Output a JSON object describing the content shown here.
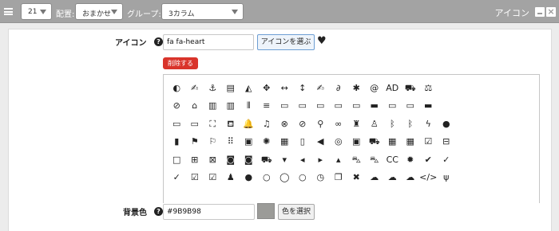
{
  "topbar": {
    "count_value": "21",
    "placement_label": "配置:",
    "placement_value": "おまかせ",
    "group_label": "グループ:",
    "group_value": "3カラム",
    "panel_title": "アイコン",
    "minimize_icon": "minus-icon",
    "close_icon": "close-icon"
  },
  "form": {
    "icon_label": "アイコン",
    "icon_value": "fa fa-heart",
    "choose_icon_button": "アイコンを選ぶ",
    "preview_icon": "♥",
    "delete_button": "削除する",
    "bg_label": "背景色",
    "bg_value": "#9B9B98",
    "bg_color": "#9B9B98",
    "choose_color_button": "色を選択"
  },
  "icons": [
    {
      "name": "adjust-icon",
      "g": "◐"
    },
    {
      "name": "american-sign-language-icon",
      "g": "✍"
    },
    {
      "name": "anchor-icon",
      "g": "⚓"
    },
    {
      "name": "archive-icon",
      "g": "▤"
    },
    {
      "name": "area-chart-icon",
      "g": "◭"
    },
    {
      "name": "arrows-icon",
      "g": "✥"
    },
    {
      "name": "arrows-h-icon",
      "g": "↔"
    },
    {
      "name": "arrows-v-icon",
      "g": "↕"
    },
    {
      "name": "asl-interpreting-icon",
      "g": "✍"
    },
    {
      "name": "assistive-listening-icon",
      "g": "∂"
    },
    {
      "name": "asterisk-icon",
      "g": "✱"
    },
    {
      "name": "at-icon",
      "g": "@"
    },
    {
      "name": "audio-description-icon",
      "g": "AD"
    },
    {
      "name": "automobile-icon",
      "g": "⛟"
    },
    {
      "name": "balance-scale-icon",
      "g": "⚖"
    },
    {
      "name": "blank-1",
      "g": ""
    },
    {
      "name": "blank-2",
      "g": ""
    },
    {
      "name": "blank-3",
      "g": ""
    },
    {
      "name": "blank-4",
      "g": ""
    },
    {
      "name": "blank-5",
      "g": ""
    },
    {
      "name": "ban-icon",
      "g": "⊘"
    },
    {
      "name": "bank-icon",
      "g": "⌂"
    },
    {
      "name": "bar-chart-icon",
      "g": "▥"
    },
    {
      "name": "bar-chart-o-icon",
      "g": "▥"
    },
    {
      "name": "barcode-icon",
      "g": "⦀"
    },
    {
      "name": "bars-icon",
      "g": "≡"
    },
    {
      "name": "battery-empty-icon",
      "g": "▭"
    },
    {
      "name": "battery-quarter-icon",
      "g": "▭"
    },
    {
      "name": "battery-half-icon",
      "g": "▭"
    },
    {
      "name": "battery-three-quarters-icon",
      "g": "▭"
    },
    {
      "name": "battery-empty-2-icon",
      "g": "▭"
    },
    {
      "name": "battery-full-icon",
      "g": "▬"
    },
    {
      "name": "battery-quarter-2-icon",
      "g": "▭"
    },
    {
      "name": "battery-half-2-icon",
      "g": "▭"
    },
    {
      "name": "battery-full-2-icon",
      "g": "▬"
    },
    {
      "name": "blank-6",
      "g": ""
    },
    {
      "name": "blank-7",
      "g": ""
    },
    {
      "name": "blank-8",
      "g": ""
    },
    {
      "name": "blank-9",
      "g": ""
    },
    {
      "name": "blank-10",
      "g": ""
    },
    {
      "name": "battery-three-quarters-2-icon",
      "g": "▭"
    },
    {
      "name": "battery-half-3-icon",
      "g": "▭"
    },
    {
      "name": "bed-icon",
      "g": "⛶"
    },
    {
      "name": "beer-icon",
      "g": "⛾"
    },
    {
      "name": "bell-icon",
      "g": "🔔"
    },
    {
      "name": "bell-o-icon",
      "g": "♫"
    },
    {
      "name": "bell-slash-icon",
      "g": "⊗"
    },
    {
      "name": "bell-slash-o-icon",
      "g": "⊘"
    },
    {
      "name": "bicycle-icon",
      "g": "⚲"
    },
    {
      "name": "binoculars-icon",
      "g": "∞"
    },
    {
      "name": "birthday-cake-icon",
      "g": "♜"
    },
    {
      "name": "blind-icon",
      "g": "♙"
    },
    {
      "name": "bluetooth-icon",
      "g": "ᛒ"
    },
    {
      "name": "bluetooth-b-icon",
      "g": "ᛒ"
    },
    {
      "name": "bolt-icon",
      "g": "ϟ"
    },
    {
      "name": "bomb-icon",
      "g": "●"
    },
    {
      "name": "blank-11",
      "g": ""
    },
    {
      "name": "blank-12",
      "g": ""
    },
    {
      "name": "blank-13",
      "g": ""
    },
    {
      "name": "blank-14",
      "g": ""
    },
    {
      "name": "book-icon",
      "g": "▮"
    },
    {
      "name": "bookmark-icon",
      "g": "⚑"
    },
    {
      "name": "bookmark-o-icon",
      "g": "⚐"
    },
    {
      "name": "braille-icon",
      "g": "⠿"
    },
    {
      "name": "briefcase-icon",
      "g": "▣"
    },
    {
      "name": "bug-icon",
      "g": "✺"
    },
    {
      "name": "building-icon",
      "g": "▦"
    },
    {
      "name": "building-o-icon",
      "g": "▯"
    },
    {
      "name": "bullhorn-icon",
      "g": "◀"
    },
    {
      "name": "bullseye-icon",
      "g": "◎"
    },
    {
      "name": "bus-icon",
      "g": "▣"
    },
    {
      "name": "cab-icon",
      "g": "⛟"
    },
    {
      "name": "calculator-icon",
      "g": "▦"
    },
    {
      "name": "calendar-icon",
      "g": "▦"
    },
    {
      "name": "calendar-check-o-icon",
      "g": "☑"
    },
    {
      "name": "calendar-minus-o-icon",
      "g": "⊟"
    },
    {
      "name": "blank-15",
      "g": ""
    },
    {
      "name": "blank-16",
      "g": ""
    },
    {
      "name": "blank-17",
      "g": ""
    },
    {
      "name": "blank-18",
      "g": ""
    },
    {
      "name": "calendar-o-icon",
      "g": "□"
    },
    {
      "name": "calendar-plus-o-icon",
      "g": "⊞"
    },
    {
      "name": "calendar-times-o-icon",
      "g": "⊠"
    },
    {
      "name": "camera-icon",
      "g": "◙"
    },
    {
      "name": "camera-retro-icon",
      "g": "◙"
    },
    {
      "name": "car-icon",
      "g": "⛟"
    },
    {
      "name": "caret-square-o-down-icon",
      "g": "▾"
    },
    {
      "name": "caret-square-o-left-icon",
      "g": "◂"
    },
    {
      "name": "caret-square-o-right-icon",
      "g": "▸"
    },
    {
      "name": "caret-square-o-up-icon",
      "g": "▴"
    },
    {
      "name": "cart-arrow-down-icon",
      "g": "⛍"
    },
    {
      "name": "cart-plus-icon",
      "g": "⛍"
    },
    {
      "name": "cc-icon",
      "g": "CC"
    },
    {
      "name": "certificate-icon",
      "g": "✹"
    },
    {
      "name": "check-icon",
      "g": "✔"
    },
    {
      "name": "check-circle-icon",
      "g": "✓"
    },
    {
      "name": "blank-19",
      "g": ""
    },
    {
      "name": "blank-20",
      "g": ""
    },
    {
      "name": "blank-21",
      "g": ""
    },
    {
      "name": "blank-22",
      "g": ""
    },
    {
      "name": "check-circle-o-icon",
      "g": "✓"
    },
    {
      "name": "check-square-icon",
      "g": "☑"
    },
    {
      "name": "check-square-o-icon",
      "g": "☑"
    },
    {
      "name": "child-icon",
      "g": "♟"
    },
    {
      "name": "circle-icon",
      "g": "●"
    },
    {
      "name": "circle-o-notch-icon",
      "g": "○"
    },
    {
      "name": "circle-thin-icon",
      "g": "◯"
    },
    {
      "name": "circle-o-icon",
      "g": "○"
    },
    {
      "name": "clock-o-icon",
      "g": "◷"
    },
    {
      "name": "clone-icon",
      "g": "❐"
    },
    {
      "name": "close-icon",
      "g": "✖"
    },
    {
      "name": "cloud-icon",
      "g": "☁"
    },
    {
      "name": "cloud-download-icon",
      "g": "☁"
    },
    {
      "name": "cloud-upload-icon",
      "g": "☁"
    },
    {
      "name": "code-icon",
      "g": "</>"
    },
    {
      "name": "code-fork-icon",
      "g": "ψ"
    },
    {
      "name": "blank-23",
      "g": ""
    },
    {
      "name": "blank-24",
      "g": ""
    },
    {
      "name": "blank-25",
      "g": ""
    },
    {
      "name": "blank-26",
      "g": ""
    }
  ]
}
